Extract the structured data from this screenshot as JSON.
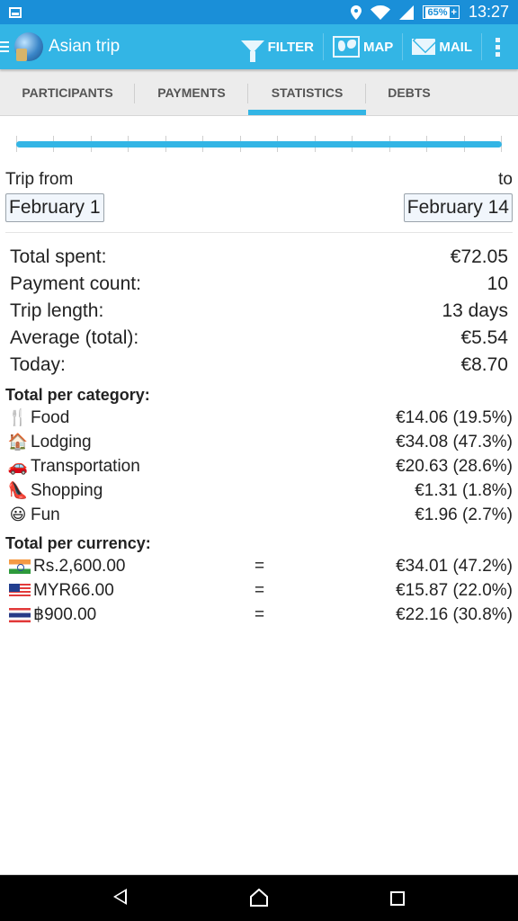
{
  "status_bar": {
    "time": "13:27",
    "battery_percent": "65%",
    "icons": [
      "image-notification-icon",
      "location-icon",
      "wifi-icon",
      "signal-icon",
      "battery-charging-icon"
    ]
  },
  "app_bar": {
    "title": "Asian trip",
    "actions": [
      {
        "label": "FILTER",
        "icon": "filter-icon"
      },
      {
        "label": "MAP",
        "icon": "map-icon"
      },
      {
        "label": "MAIL",
        "icon": "mail-icon"
      }
    ]
  },
  "tabs": [
    {
      "label": "PARTICIPANTS",
      "active": false
    },
    {
      "label": "PAYMENTS",
      "active": false
    },
    {
      "label": "STATISTICS",
      "active": true
    },
    {
      "label": "DEBTS",
      "active": false
    }
  ],
  "range_slider": {
    "tick_count": 14,
    "selected_start_fraction": 0,
    "selected_end_fraction": 1
  },
  "trip": {
    "from_label": "Trip from",
    "to_label": "to",
    "from_date": "February 1",
    "to_date": "February 14"
  },
  "stats": [
    {
      "label": "Total spent:",
      "value": "€72.05"
    },
    {
      "label": "Payment count:",
      "value": "10"
    },
    {
      "label": "Trip length:",
      "value": "13 days"
    },
    {
      "label": "Average (total):",
      "value": "€5.54"
    },
    {
      "label": "Today:",
      "value": "€8.70"
    }
  ],
  "per_category": {
    "title": "Total per category:",
    "items": [
      {
        "emoji": "🍴",
        "icon": "fork-knife-icon",
        "name": "Food",
        "value": "€14.06 (19.5%)"
      },
      {
        "emoji": "🏠",
        "icon": "house-icon",
        "name": "Lodging",
        "value": "€34.08 (47.3%)"
      },
      {
        "emoji": "🚗",
        "icon": "car-icon",
        "name": "Transportation",
        "value": "€20.63 (28.6%)"
      },
      {
        "emoji": "👠",
        "icon": "high-heel-icon",
        "name": "Shopping",
        "value": "€1.31 (1.8%)"
      },
      {
        "emoji": "😃",
        "icon": "smiley-icon",
        "name": "Fun",
        "value": "€1.96 (2.7%)"
      }
    ]
  },
  "per_currency": {
    "title": "Total per currency:",
    "items": [
      {
        "flag": "india-flag-icon",
        "amount": "Rs.2,600.00",
        "eq": "=",
        "value": "€34.01 (47.2%)"
      },
      {
        "flag": "malaysia-flag-icon",
        "amount": "MYR66.00",
        "eq": "=",
        "value": "€15.87 (22.0%)"
      },
      {
        "flag": "thailand-flag-icon",
        "amount": "฿900.00",
        "eq": "=",
        "value": "€22.16 (30.8%)"
      }
    ]
  },
  "colors": {
    "status_bar": "#1a8fd8",
    "app_bar": "#33b5e5",
    "accent": "#33b5e5",
    "tab_bg": "#ececec"
  }
}
